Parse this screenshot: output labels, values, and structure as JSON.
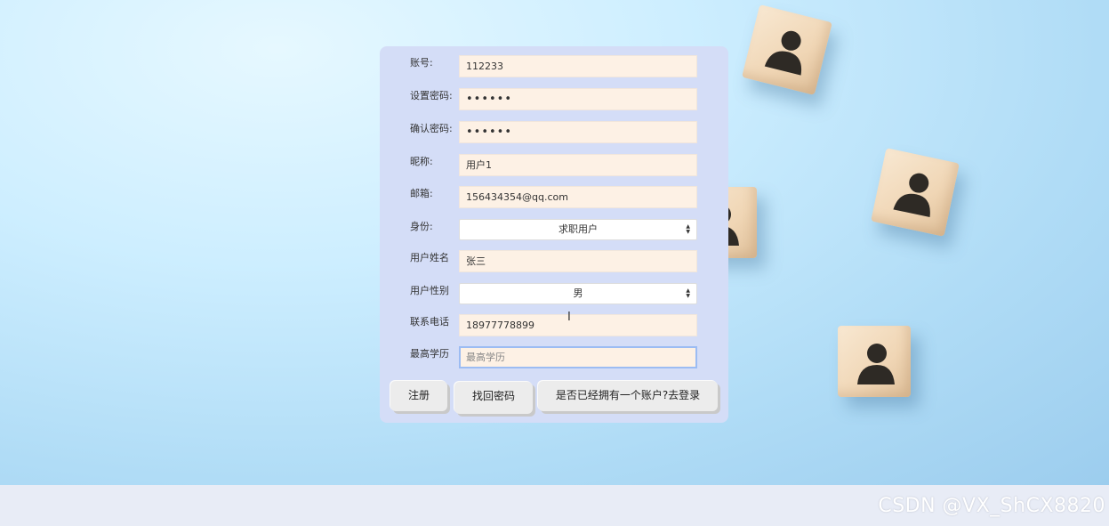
{
  "form": {
    "fields": [
      {
        "label": "账号:",
        "value": "112233"
      },
      {
        "label": "设置密码:",
        "value": "••••••"
      },
      {
        "label": "确认密码:",
        "value": "••••••"
      },
      {
        "label": "昵称:",
        "value": "用户1"
      },
      {
        "label": "邮箱:",
        "value": "156434354@qq.com"
      },
      {
        "label": "身份:",
        "value": "求职用户"
      },
      {
        "label": "用户姓名",
        "value": "张三"
      },
      {
        "label": "用户性别",
        "value": "男"
      },
      {
        "label": "联系电话",
        "value": "18977778899"
      },
      {
        "label": "最高学历",
        "placeholder": "最高学历"
      }
    ],
    "buttons": {
      "register": "注册",
      "recover": "找回密码",
      "login": "是否已经拥有一个账户?去登录"
    }
  },
  "watermark": "CSDN @VX_ShCX8820",
  "icons": {
    "background_cube": "person-icon",
    "select_arrow": "updown-arrow-icon",
    "text_cursor": "i-beam-cursor-icon"
  }
}
